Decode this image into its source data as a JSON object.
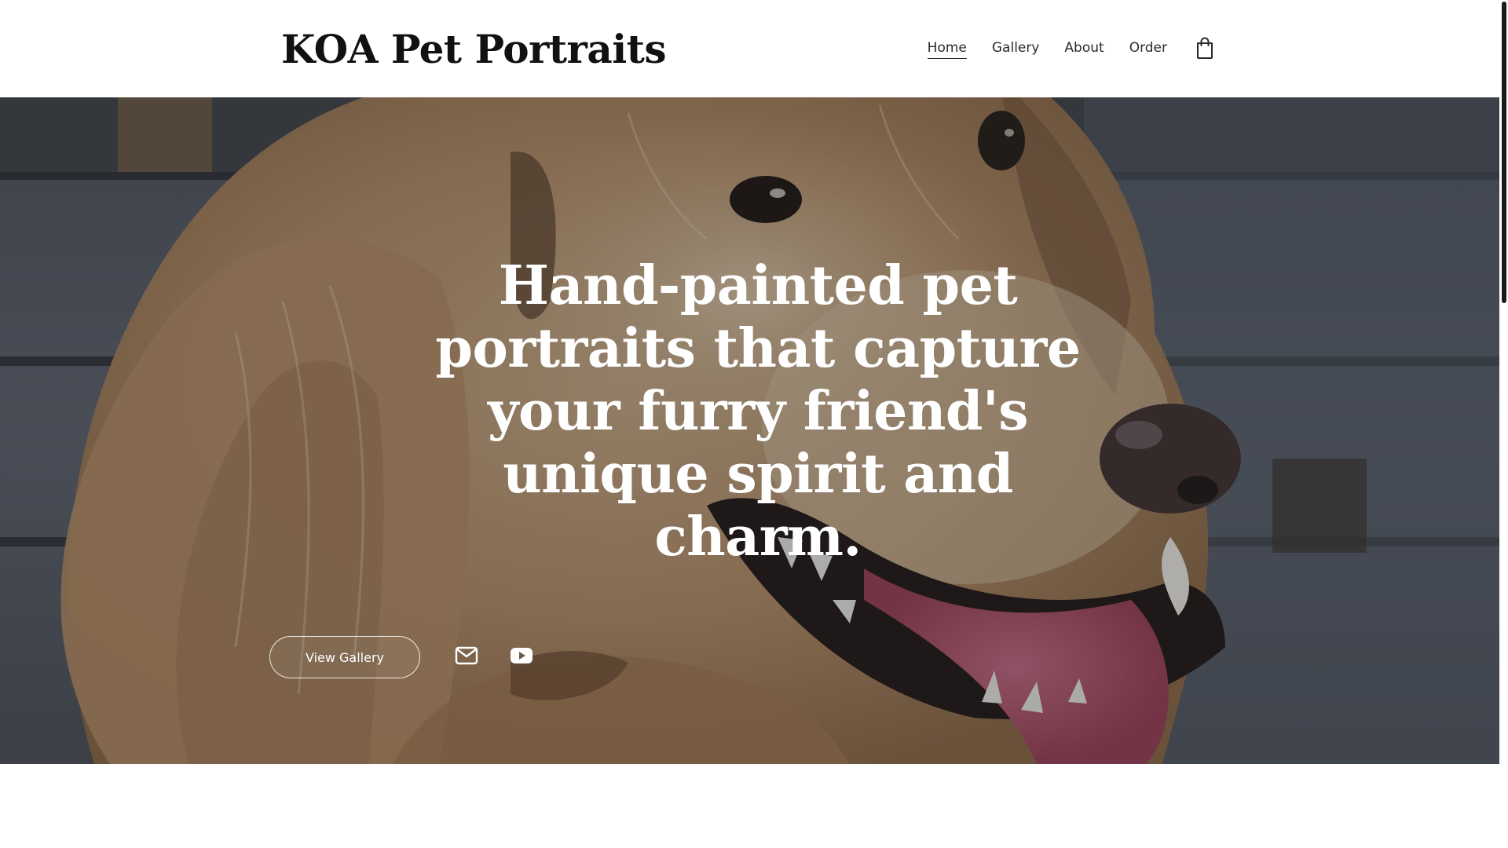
{
  "header": {
    "site_title": "KOA Pet Portraits",
    "nav": [
      {
        "label": "Home",
        "active": true
      },
      {
        "label": "Gallery",
        "active": false
      },
      {
        "label": "About",
        "active": false
      },
      {
        "label": "Order",
        "active": false
      }
    ],
    "cart_icon": "shopping-bag-icon"
  },
  "hero": {
    "background": "painted golden retriever portrait",
    "headline": "Hand-painted pet portraits that capture your furry friend's unique spirit and charm.",
    "cta_label": "View Gallery",
    "social_icons": [
      "email-icon",
      "youtube-icon"
    ]
  },
  "colors": {
    "text_dark": "#111111",
    "headline": "#ffffff",
    "overlay": "rgba(30,30,30,0.32)"
  }
}
